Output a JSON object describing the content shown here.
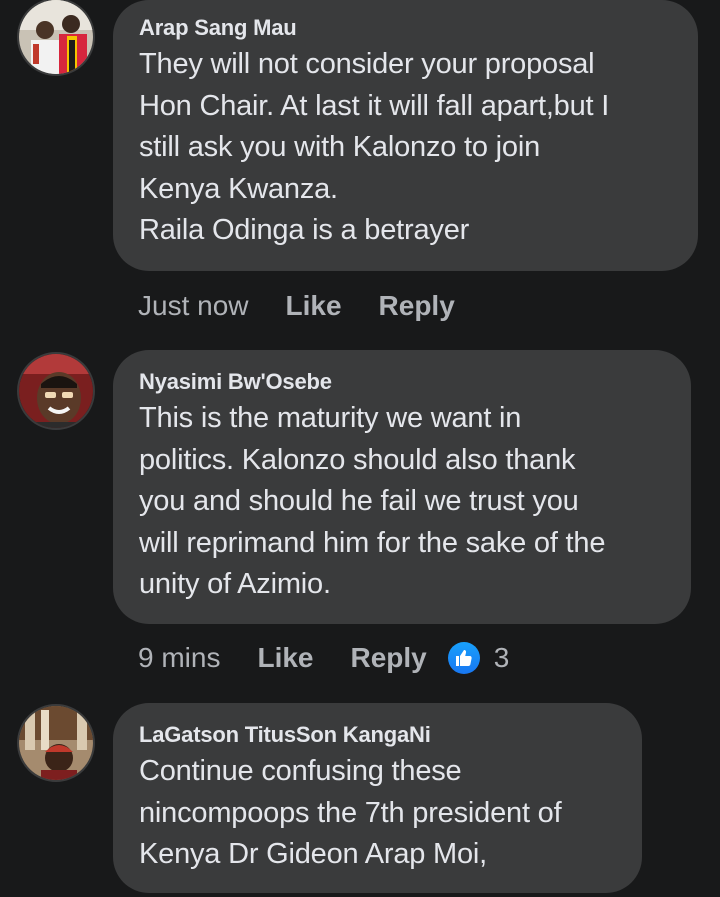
{
  "comments": [
    {
      "author": "Arap Sang Mau",
      "text": "They will not consider your proposal\nHon Chair. At last it will fall apart,but I\nstill ask you with Kalonzo to join\nKenya Kwanza.\nRaila Odinga is a betrayer",
      "time": "Just now",
      "like_label": "Like",
      "reply_label": "Reply"
    },
    {
      "author": "Nyasimi Bw'Osebe",
      "text": "This is the maturity we want in\npolitics. Kalonzo should also thank\nyou and should he fail we trust you\nwill reprimand him for the sake of the\nunity of Azimio.",
      "time": "9 mins",
      "like_label": "Like",
      "reply_label": "Reply",
      "reaction_count": "3",
      "reaction_icon": "thumbs-up-icon",
      "reaction_color": "#1877f2"
    },
    {
      "author": "LaGatson TitusSon KangaNi",
      "text": "Continue confusing these\nnincompoops the 7th president of\nKenya Dr Gideon Arap Moi,"
    }
  ],
  "colors": {
    "background": "#18191a",
    "bubble": "#3a3b3c",
    "text": "#e4e6eb",
    "secondary_text": "#b0b3b8"
  }
}
